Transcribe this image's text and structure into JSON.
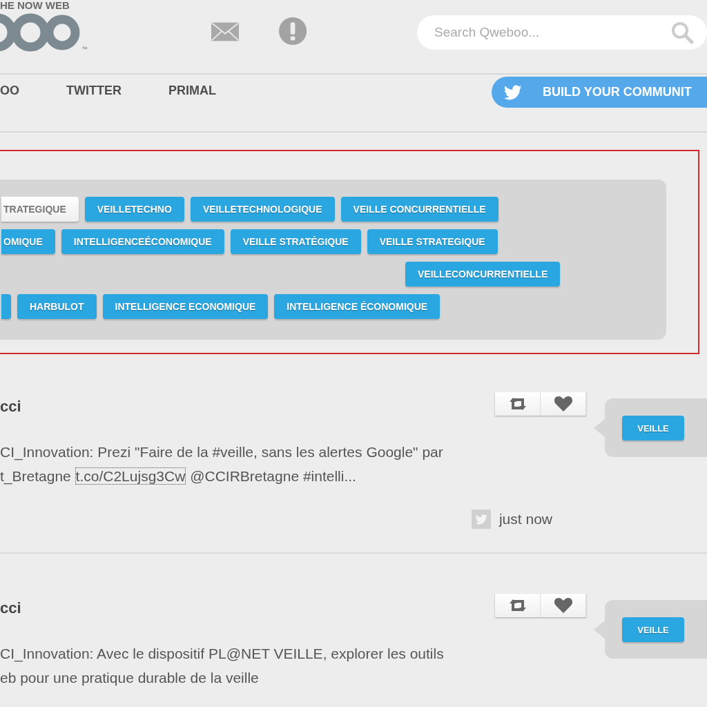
{
  "logo": {
    "tagline": "HE NOW WEB",
    "trademark": "™"
  },
  "search": {
    "placeholder": "Search Qweboo..."
  },
  "nav": {
    "tabs": [
      {
        "label": "OO"
      },
      {
        "label": "TWITTER"
      },
      {
        "label": "PRIMAL"
      }
    ],
    "cta": {
      "label": "BUILD YOUR COMMUNIT"
    }
  },
  "tag_cloud": {
    "rows": [
      [
        {
          "label": "TRATEGIQUE",
          "selected": true
        },
        {
          "label": "VEILLETECHNO",
          "selected": false
        },
        {
          "label": "VEILLETECHNOLOGIQUE",
          "selected": false
        },
        {
          "label": "VEILLE CONCURRENTIELLE",
          "selected": false
        }
      ],
      [
        {
          "label": "OMIQUE",
          "selected": false
        },
        {
          "label": "INTELLIGENCEÉCONOMIQUE",
          "selected": false
        },
        {
          "label": "VEILLE STRATÉGIQUE",
          "selected": false
        },
        {
          "label": "VEILLE STRATEGIQUE",
          "selected": false
        }
      ],
      [
        {
          "label": "VEILLECONCURRENTIELLE",
          "selected": false
        }
      ],
      [
        {
          "kind": "clipped",
          "selected": false
        },
        {
          "label": "HARBULOT",
          "selected": false
        },
        {
          "label": "INTELLIGENCE ECONOMIQUE",
          "selected": false
        },
        {
          "label": "INTELLIGENCE ÉCONOMIQUE",
          "selected": false
        }
      ]
    ]
  },
  "posts": [
    {
      "author": "cci",
      "lines": [
        [
          {
            "kind": "text",
            "text": "CI_Innovation: Prezi \"Faire de la #veille, sans les alertes Google\" par"
          }
        ],
        [
          {
            "kind": "text",
            "text": "t_Bretagne "
          },
          {
            "kind": "link",
            "text": "t.co/C2Lujsg3Cw"
          },
          {
            "kind": "text",
            "text": " @CCIRBretagne #intelli..."
          }
        ]
      ],
      "tag": "VEILLE",
      "time": "just now"
    },
    {
      "author": "cci",
      "lines": [
        [
          {
            "kind": "text",
            "text": "CI_Innovation: Avec le dispositif PL@NET VEILLE, explorer les outils"
          }
        ],
        [
          {
            "kind": "text",
            "text": "eb pour une pratique durable de la veille"
          }
        ]
      ],
      "tag": "VEILLE"
    }
  ]
}
